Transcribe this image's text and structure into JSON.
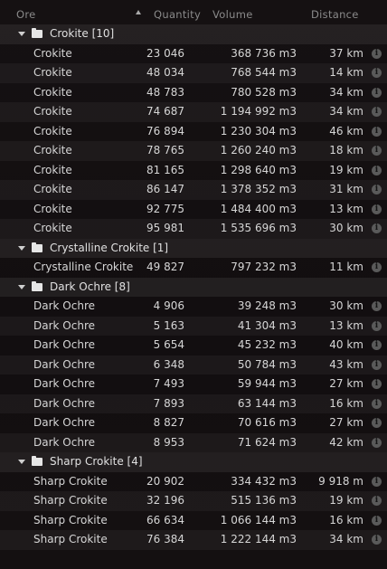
{
  "header": {
    "ore": "Ore",
    "quantity": "Quantity",
    "volume": "Volume",
    "distance": "Distance"
  },
  "groups": [
    {
      "label": "Crokite [10]",
      "rows": [
        {
          "name": "Crokite",
          "qty": "23 046",
          "vol": "368 736 m3",
          "dist": "37 km"
        },
        {
          "name": "Crokite",
          "qty": "48 034",
          "vol": "768 544 m3",
          "dist": "14 km"
        },
        {
          "name": "Crokite",
          "qty": "48 783",
          "vol": "780 528 m3",
          "dist": "34 km"
        },
        {
          "name": "Crokite",
          "qty": "74 687",
          "vol": "1 194 992 m3",
          "dist": "34 km"
        },
        {
          "name": "Crokite",
          "qty": "76 894",
          "vol": "1 230 304 m3",
          "dist": "46 km"
        },
        {
          "name": "Crokite",
          "qty": "78 765",
          "vol": "1 260 240 m3",
          "dist": "18 km"
        },
        {
          "name": "Crokite",
          "qty": "81 165",
          "vol": "1 298 640 m3",
          "dist": "19 km"
        },
        {
          "name": "Crokite",
          "qty": "86 147",
          "vol": "1 378 352 m3",
          "dist": "31 km"
        },
        {
          "name": "Crokite",
          "qty": "92 775",
          "vol": "1 484 400 m3",
          "dist": "13 km"
        },
        {
          "name": "Crokite",
          "qty": "95 981",
          "vol": "1 535 696 m3",
          "dist": "30 km"
        }
      ]
    },
    {
      "label": "Crystalline Crokite [1]",
      "rows": [
        {
          "name": "Crystalline Crokite",
          "qty": "49 827",
          "vol": "797 232 m3",
          "dist": "11 km"
        }
      ]
    },
    {
      "label": "Dark Ochre [8]",
      "rows": [
        {
          "name": "Dark Ochre",
          "qty": "4 906",
          "vol": "39 248 m3",
          "dist": "30 km"
        },
        {
          "name": "Dark Ochre",
          "qty": "5 163",
          "vol": "41 304 m3",
          "dist": "13 km"
        },
        {
          "name": "Dark Ochre",
          "qty": "5 654",
          "vol": "45 232 m3",
          "dist": "40 km"
        },
        {
          "name": "Dark Ochre",
          "qty": "6 348",
          "vol": "50 784 m3",
          "dist": "43 km"
        },
        {
          "name": "Dark Ochre",
          "qty": "7 493",
          "vol": "59 944 m3",
          "dist": "27 km"
        },
        {
          "name": "Dark Ochre",
          "qty": "7 893",
          "vol": "63 144 m3",
          "dist": "16 km"
        },
        {
          "name": "Dark Ochre",
          "qty": "8 827",
          "vol": "70 616 m3",
          "dist": "27 km"
        },
        {
          "name": "Dark Ochre",
          "qty": "8 953",
          "vol": "71 624 m3",
          "dist": "42 km"
        }
      ]
    },
    {
      "label": "Sharp Crokite [4]",
      "rows": [
        {
          "name": "Sharp Crokite",
          "qty": "20 902",
          "vol": "334 432 m3",
          "dist": "9 918 m"
        },
        {
          "name": "Sharp Crokite",
          "qty": "32 196",
          "vol": "515 136 m3",
          "dist": "19 km"
        },
        {
          "name": "Sharp Crokite",
          "qty": "66 634",
          "vol": "1 066 144 m3",
          "dist": "16 km"
        },
        {
          "name": "Sharp Crokite",
          "qty": "76 384",
          "vol": "1 222 144 m3",
          "dist": "34 km"
        }
      ]
    }
  ],
  "icons": {
    "info": "info-icon",
    "folder": "folder-icon",
    "caret": "caret-down-icon",
    "sort": "sort-ascending-icon"
  },
  "info_glyph": "i"
}
